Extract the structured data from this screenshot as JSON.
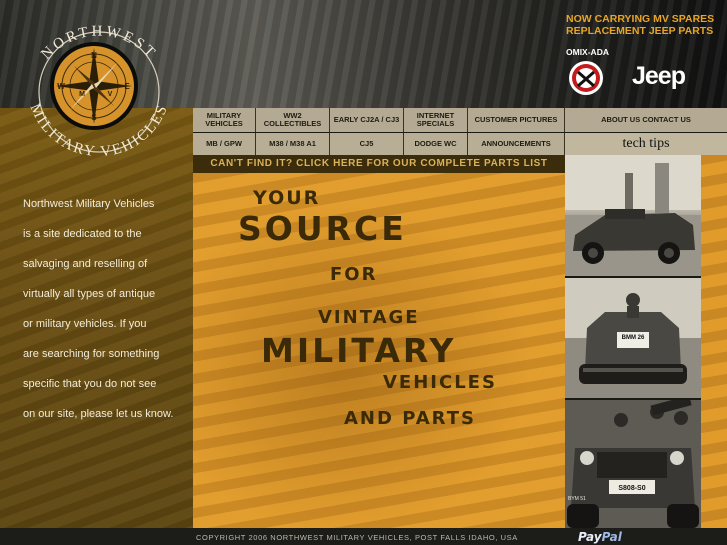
{
  "brand": {
    "logo_top_text": "NORTHWEST",
    "logo_bottom_text": "MILITARY VEHICLES",
    "compass_letters": [
      "N",
      "E",
      "W",
      "S"
    ],
    "compass_inner_letters": [
      "M",
      "V"
    ]
  },
  "header": {
    "promo_line_1": "NOW CARRYING MV SPARES",
    "promo_line_2": "REPLACEMENT JEEP PARTS",
    "omix_label": "OMIX-ADA",
    "jeep_label": "Jeep"
  },
  "nav": {
    "row1": [
      {
        "label": "MILITARY VEHICLES"
      },
      {
        "label": "WW2 COLLECTIBLES"
      },
      {
        "label": "EARLY CJ2A / CJ3"
      },
      {
        "label": "INTERNET SPECIALS"
      },
      {
        "label": "CUSTOMER PICTURES"
      },
      {
        "label": "ABOUT US CONTACT US"
      }
    ],
    "row2": [
      {
        "label": "MB / GPW"
      },
      {
        "label": "M38 / M38 A1"
      },
      {
        "label": "CJ5"
      },
      {
        "label": "DODGE WC"
      },
      {
        "label": "ANNOUNCEMENTS"
      },
      {
        "label": "tech tips"
      }
    ]
  },
  "parts_bar": {
    "label": "CAN'T FIND IT? CLICK HERE FOR OUR COMPLETE PARTS LIST"
  },
  "slogan": {
    "line1": "YOUR",
    "line2": "SOURCE",
    "line3": "FOR",
    "line4": "VINTAGE",
    "line5": "MILITARY",
    "line6": "VEHICLES",
    "line7": "AND PARTS"
  },
  "description": {
    "lines": [
      "Northwest Military Vehicles",
      "is a site dedicated to the",
      "salvaging and reselling of",
      "virtually all types of antique",
      "or military vehicles. If you",
      "are searching for something",
      "specific that you do not see",
      "on our site, please let us know."
    ]
  },
  "photos": {
    "photo2_plate": "BMM 26",
    "photo3_plate": "S808-S0",
    "photo3_caption": "BYM 51"
  },
  "footer": {
    "copyright": "COPYRIGHT 2006 NORTHWEST MILITARY VEHICLES, POST FALLS IDAHO, USA",
    "paypal_pay": "Pay",
    "paypal_pal": "Pal"
  },
  "colors": {
    "accent_orange": "#e09b2a",
    "nav_tan": "#b4aa93",
    "promo_gold": "#e8a526",
    "dark_brown": "#3b2c0c"
  }
}
